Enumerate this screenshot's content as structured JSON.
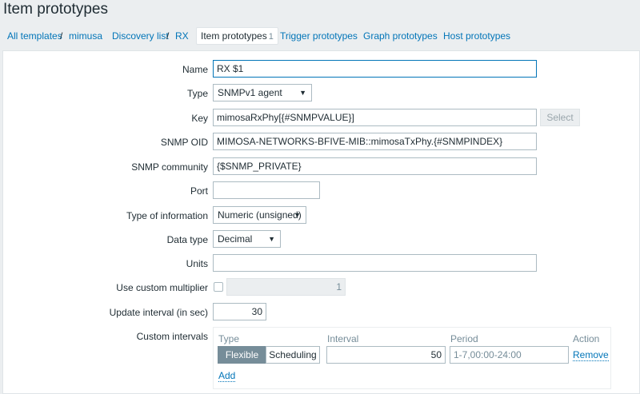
{
  "page": {
    "title": "Item prototypes"
  },
  "breadcrumb": {
    "all_templates": "All templates",
    "sep": "/",
    "template": "mimusa",
    "discovery_list": "Discovery list",
    "discovery_rule": "RX",
    "item_prototypes": "Item prototypes",
    "item_prototypes_count": "1",
    "trigger_prototypes": "Trigger prototypes",
    "graph_prototypes": "Graph prototypes",
    "host_prototypes": "Host prototypes"
  },
  "form": {
    "name": {
      "label": "Name",
      "value": "RX $1"
    },
    "type": {
      "label": "Type",
      "value": "SNMPv1 agent"
    },
    "key": {
      "label": "Key",
      "value": "mimosaRxPhy[{#SNMPVALUE}]",
      "select_label": "Select"
    },
    "snmp_oid": {
      "label": "SNMP OID",
      "value": "MIMOSA-NETWORKS-BFIVE-MIB::mimosaTxPhy.{#SNMPINDEX}"
    },
    "snmp_community": {
      "label": "SNMP community",
      "value": "{$SNMP_PRIVATE}"
    },
    "port": {
      "label": "Port",
      "value": ""
    },
    "type_of_information": {
      "label": "Type of information",
      "value": "Numeric (unsigned)"
    },
    "data_type": {
      "label": "Data type",
      "value": "Decimal"
    },
    "units": {
      "label": "Units",
      "value": ""
    },
    "custom_multiplier": {
      "label": "Use custom multiplier",
      "value": "1",
      "checked": false
    },
    "update_interval": {
      "label": "Update interval (in sec)",
      "value": "30"
    },
    "custom_intervals": {
      "label": "Custom intervals",
      "col_type": "Type",
      "col_interval": "Interval",
      "col_period": "Period",
      "col_action": "Action",
      "flexible": "Flexible",
      "scheduling": "Scheduling",
      "interval_value": "50",
      "period_value": "1-7,00:00-24:00",
      "remove": "Remove",
      "add": "Add"
    }
  },
  "icons": {
    "caret": "caret-down-icon"
  },
  "colors": {
    "link": "#0275b8",
    "background": "#ebeef0",
    "active_segment": "#768d99"
  }
}
